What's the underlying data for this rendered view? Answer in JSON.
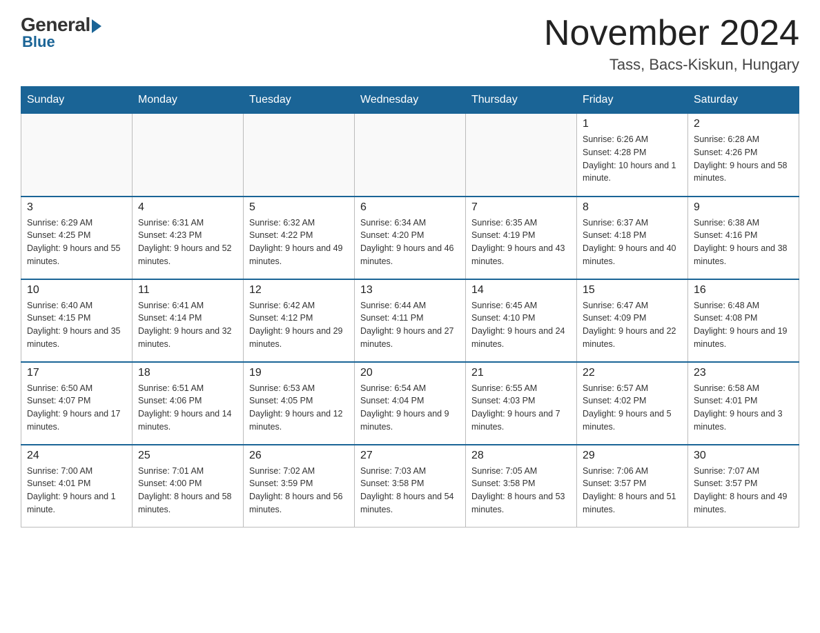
{
  "header": {
    "logo": {
      "general": "General",
      "blue": "Blue"
    },
    "month": "November 2024",
    "location": "Tass, Bacs-Kiskun, Hungary"
  },
  "days_of_week": [
    "Sunday",
    "Monday",
    "Tuesday",
    "Wednesday",
    "Thursday",
    "Friday",
    "Saturday"
  ],
  "weeks": [
    [
      {
        "day": "",
        "info": ""
      },
      {
        "day": "",
        "info": ""
      },
      {
        "day": "",
        "info": ""
      },
      {
        "day": "",
        "info": ""
      },
      {
        "day": "",
        "info": ""
      },
      {
        "day": "1",
        "info": "Sunrise: 6:26 AM\nSunset: 4:28 PM\nDaylight: 10 hours and 1 minute."
      },
      {
        "day": "2",
        "info": "Sunrise: 6:28 AM\nSunset: 4:26 PM\nDaylight: 9 hours and 58 minutes."
      }
    ],
    [
      {
        "day": "3",
        "info": "Sunrise: 6:29 AM\nSunset: 4:25 PM\nDaylight: 9 hours and 55 minutes."
      },
      {
        "day": "4",
        "info": "Sunrise: 6:31 AM\nSunset: 4:23 PM\nDaylight: 9 hours and 52 minutes."
      },
      {
        "day": "5",
        "info": "Sunrise: 6:32 AM\nSunset: 4:22 PM\nDaylight: 9 hours and 49 minutes."
      },
      {
        "day": "6",
        "info": "Sunrise: 6:34 AM\nSunset: 4:20 PM\nDaylight: 9 hours and 46 minutes."
      },
      {
        "day": "7",
        "info": "Sunrise: 6:35 AM\nSunset: 4:19 PM\nDaylight: 9 hours and 43 minutes."
      },
      {
        "day": "8",
        "info": "Sunrise: 6:37 AM\nSunset: 4:18 PM\nDaylight: 9 hours and 40 minutes."
      },
      {
        "day": "9",
        "info": "Sunrise: 6:38 AM\nSunset: 4:16 PM\nDaylight: 9 hours and 38 minutes."
      }
    ],
    [
      {
        "day": "10",
        "info": "Sunrise: 6:40 AM\nSunset: 4:15 PM\nDaylight: 9 hours and 35 minutes."
      },
      {
        "day": "11",
        "info": "Sunrise: 6:41 AM\nSunset: 4:14 PM\nDaylight: 9 hours and 32 minutes."
      },
      {
        "day": "12",
        "info": "Sunrise: 6:42 AM\nSunset: 4:12 PM\nDaylight: 9 hours and 29 minutes."
      },
      {
        "day": "13",
        "info": "Sunrise: 6:44 AM\nSunset: 4:11 PM\nDaylight: 9 hours and 27 minutes."
      },
      {
        "day": "14",
        "info": "Sunrise: 6:45 AM\nSunset: 4:10 PM\nDaylight: 9 hours and 24 minutes."
      },
      {
        "day": "15",
        "info": "Sunrise: 6:47 AM\nSunset: 4:09 PM\nDaylight: 9 hours and 22 minutes."
      },
      {
        "day": "16",
        "info": "Sunrise: 6:48 AM\nSunset: 4:08 PM\nDaylight: 9 hours and 19 minutes."
      }
    ],
    [
      {
        "day": "17",
        "info": "Sunrise: 6:50 AM\nSunset: 4:07 PM\nDaylight: 9 hours and 17 minutes."
      },
      {
        "day": "18",
        "info": "Sunrise: 6:51 AM\nSunset: 4:06 PM\nDaylight: 9 hours and 14 minutes."
      },
      {
        "day": "19",
        "info": "Sunrise: 6:53 AM\nSunset: 4:05 PM\nDaylight: 9 hours and 12 minutes."
      },
      {
        "day": "20",
        "info": "Sunrise: 6:54 AM\nSunset: 4:04 PM\nDaylight: 9 hours and 9 minutes."
      },
      {
        "day": "21",
        "info": "Sunrise: 6:55 AM\nSunset: 4:03 PM\nDaylight: 9 hours and 7 minutes."
      },
      {
        "day": "22",
        "info": "Sunrise: 6:57 AM\nSunset: 4:02 PM\nDaylight: 9 hours and 5 minutes."
      },
      {
        "day": "23",
        "info": "Sunrise: 6:58 AM\nSunset: 4:01 PM\nDaylight: 9 hours and 3 minutes."
      }
    ],
    [
      {
        "day": "24",
        "info": "Sunrise: 7:00 AM\nSunset: 4:01 PM\nDaylight: 9 hours and 1 minute."
      },
      {
        "day": "25",
        "info": "Sunrise: 7:01 AM\nSunset: 4:00 PM\nDaylight: 8 hours and 58 minutes."
      },
      {
        "day": "26",
        "info": "Sunrise: 7:02 AM\nSunset: 3:59 PM\nDaylight: 8 hours and 56 minutes."
      },
      {
        "day": "27",
        "info": "Sunrise: 7:03 AM\nSunset: 3:58 PM\nDaylight: 8 hours and 54 minutes."
      },
      {
        "day": "28",
        "info": "Sunrise: 7:05 AM\nSunset: 3:58 PM\nDaylight: 8 hours and 53 minutes."
      },
      {
        "day": "29",
        "info": "Sunrise: 7:06 AM\nSunset: 3:57 PM\nDaylight: 8 hours and 51 minutes."
      },
      {
        "day": "30",
        "info": "Sunrise: 7:07 AM\nSunset: 3:57 PM\nDaylight: 8 hours and 49 minutes."
      }
    ]
  ]
}
